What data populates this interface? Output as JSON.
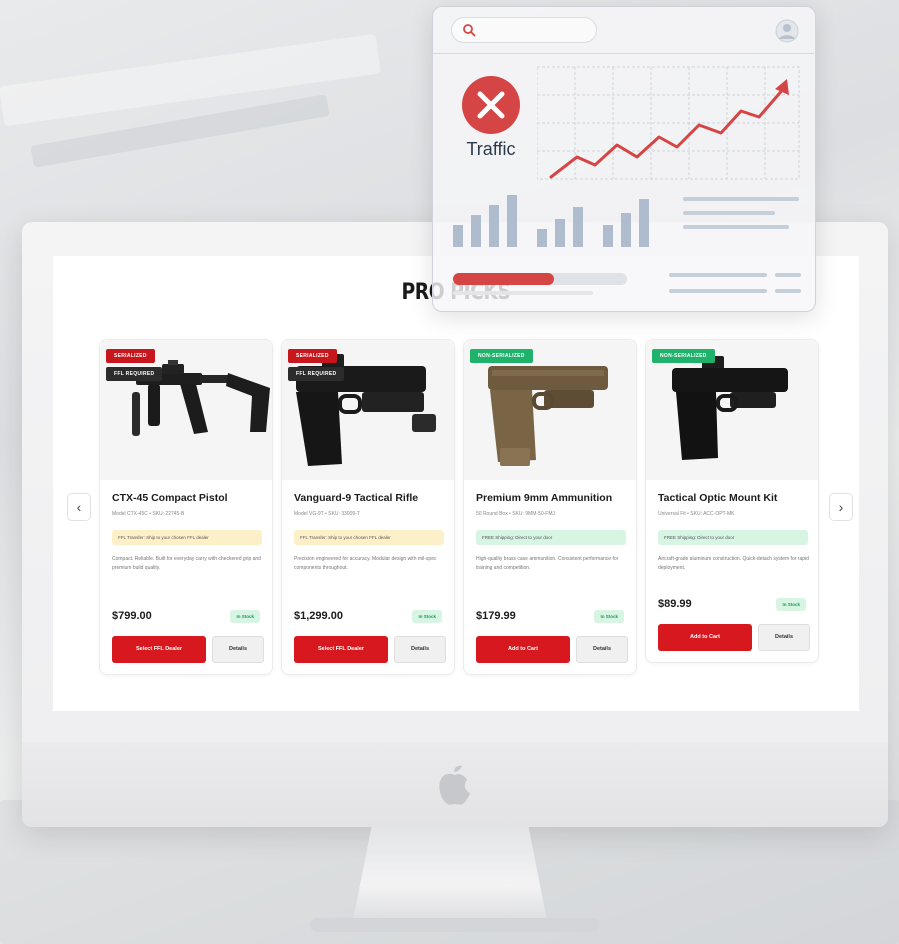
{
  "section_title": "PRO PICKS",
  "nav": {
    "prev_icon": "chevron-left-icon",
    "next_icon": "chevron-right-icon"
  },
  "products": [
    {
      "title": "CTX-45 Compact Pistol",
      "subtitle": "Model CTX-45C • SKU: 22745-B",
      "badges": [
        "SERIALIZED",
        "FFL REQUIRED"
      ],
      "notice": "FFL Transfer: Ship to your chosen FFL dealer",
      "notice_color": "yellow",
      "description": "Compact. Reliable. Built for everyday carry with checkered grip and premium build quality.",
      "price": "$799.00",
      "stock": "In Stock",
      "primary_label": "Select FFL Dealer",
      "secondary_label": "Details"
    },
    {
      "title": "Vanguard-9 Tactical Rifle",
      "subtitle": "Model VG-9T • SKU: 33009-T",
      "badges": [
        "SERIALIZED",
        "FFL REQUIRED"
      ],
      "notice": "FFL Transfer: Ship to your chosen FFL dealer",
      "notice_color": "yellow",
      "description": "Precision engineered for accuracy. Modular design with mil-spec components throughout.",
      "price": "$1,299.00",
      "stock": "In Stock",
      "primary_label": "Select FFL Dealer",
      "secondary_label": "Details"
    },
    {
      "title": "Premium 9mm Ammunition",
      "subtitle": "50 Round Box • SKU: 9MM-50-FMJ",
      "badges": [
        "NON-SERIALIZED"
      ],
      "notice": "FREE Shipping: Direct to your door",
      "notice_color": "green",
      "description": "High-quality brass case ammunition. Consistent performance for training and competition.",
      "price": "$179.99",
      "stock": "In Stock",
      "primary_label": "Add to Cart",
      "secondary_label": "Details"
    },
    {
      "title": "Tactical Optic Mount Kit",
      "subtitle": "Universal Fit • SKU: ACC-OPT-MK",
      "badges": [
        "NON-SERIALIZED"
      ],
      "notice": "FREE Shipping: Direct to your door",
      "notice_color": "green",
      "description": "Aircraft-grade aluminum construction. Quick-detach system for rapid deployment.",
      "price": "$89.99",
      "stock": "In Stock",
      "primary_label": "Add to Cart",
      "secondary_label": "Details"
    }
  ],
  "overlay": {
    "label": "Traffic",
    "status_icon": "x-circle-icon",
    "progress": 0.58,
    "colors": {
      "alert": "#d64545",
      "chart_line": "#d64545",
      "bars": "#aebccd"
    }
  },
  "colors": {
    "primary_button": "#d7191f",
    "badge_red": "#c8161d",
    "badge_green": "#1fb26b"
  }
}
